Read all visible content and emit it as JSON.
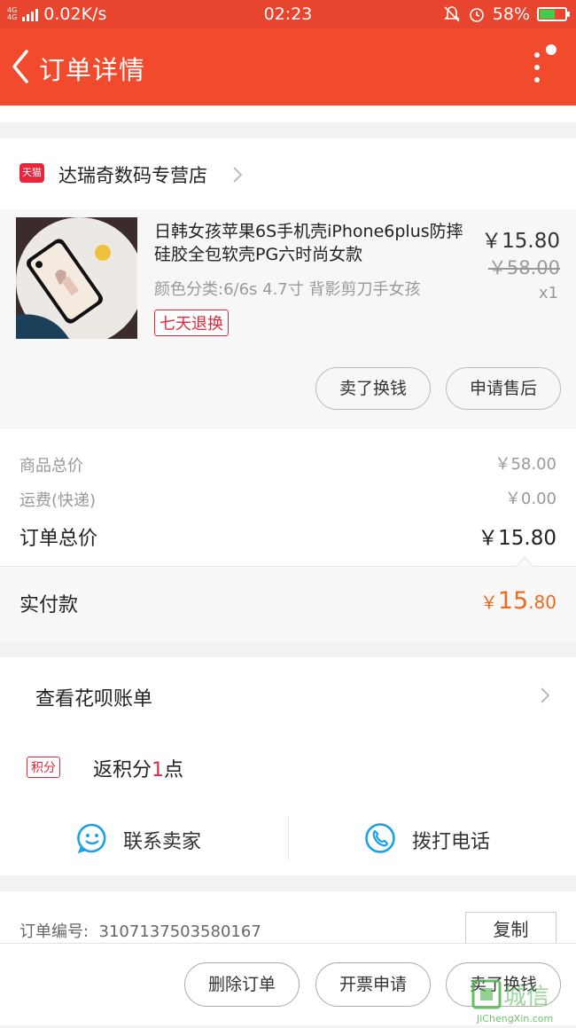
{
  "status_bar": {
    "network": "4G 4G",
    "speed": "0.02K/s",
    "time": "02:23",
    "battery": "58%",
    "battery_level": 0.58
  },
  "header": {
    "title": "订单详情"
  },
  "shop": {
    "badge": "天猫",
    "name": "达瑞奇数码专营店"
  },
  "product": {
    "title": "日韩女孩苹果6S手机壳iPhone6plus防摔硅胶全包软壳PG六时尚女款",
    "spec": "颜色分类:6/6s 4.7寸 背影剪刀手女孩",
    "tag": "七天退换",
    "price": "￥15.80",
    "original_price": "￥58.00",
    "quantity": "x1",
    "btn_sell": "卖了换钱",
    "btn_aftersale": "申请售后"
  },
  "summary": {
    "goods_total_label": "商品总价",
    "goods_total": "￥58.00",
    "shipping_label": "运费(快递)",
    "shipping": "￥0.00",
    "order_total_label": "订单总价",
    "order_total": "￥15.80",
    "paid_label": "实付款",
    "paid_currency": "￥",
    "paid_int": "15",
    "paid_dec": ".80"
  },
  "huabei": {
    "label": "查看花呗账单"
  },
  "points": {
    "tag": "积分",
    "prefix": "返积分",
    "num": "1",
    "suffix": "点"
  },
  "contact": {
    "seller": "联系卖家",
    "phone": "拨打电话"
  },
  "order": {
    "label": "订单编号:",
    "number": "3107137503580167",
    "copy": "复制"
  },
  "bottom": {
    "delete": "删除订单",
    "invoice": "开票申请",
    "sell": "卖了换钱"
  },
  "watermark": {
    "text": "城信",
    "url": "JiChengXin.com"
  },
  "colors": {
    "brand": "#f14a2c",
    "accent_red": "#e8253a",
    "paid_orange": "#f06a1c",
    "chat_blue": "#1aa1e8"
  }
}
